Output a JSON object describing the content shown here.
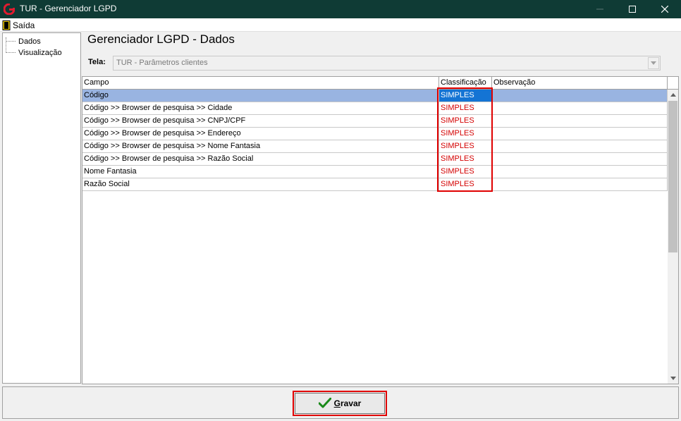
{
  "window": {
    "title": "TUR - Gerenciador LGPD"
  },
  "menu": {
    "exit_label": "Saída"
  },
  "tree": {
    "items": [
      {
        "label": "Dados"
      },
      {
        "label": "Visualização"
      }
    ]
  },
  "main": {
    "title": "Gerenciador LGPD - Dados",
    "tela_label": "Tela:",
    "tela_value": "TUR - Parâmetros clientes"
  },
  "grid": {
    "columns": [
      "Campo",
      "Classificação",
      "Observação"
    ],
    "rows": [
      {
        "campo": "Código",
        "classificacao": "SIMPLES",
        "observacao": ""
      },
      {
        "campo": "Código >> Browser de pesquisa >> Cidade",
        "classificacao": "SIMPLES",
        "observacao": ""
      },
      {
        "campo": "Código >> Browser de pesquisa >> CNPJ/CPF",
        "classificacao": "SIMPLES",
        "observacao": ""
      },
      {
        "campo": "Código >> Browser de pesquisa >> Endereço",
        "classificacao": "SIMPLES",
        "observacao": ""
      },
      {
        "campo": "Código >> Browser de pesquisa >> Nome Fantasia",
        "classificacao": "SIMPLES",
        "observacao": ""
      },
      {
        "campo": "Código >> Browser de pesquisa >> Razão Social",
        "classificacao": "SIMPLES",
        "observacao": ""
      },
      {
        "campo": "Nome Fantasia",
        "classificacao": "SIMPLES",
        "observacao": ""
      },
      {
        "campo": "Razão Social",
        "classificacao": "SIMPLES",
        "observacao": ""
      }
    ]
  },
  "footer": {
    "save_underlined": "G",
    "save_rest": "ravar"
  },
  "colors": {
    "titlebar": "#0f3b35",
    "selected_row": "#99b4e1",
    "selected_cell": "#1474d4",
    "classification_text": "#d40000",
    "highlight": "#e00000"
  }
}
